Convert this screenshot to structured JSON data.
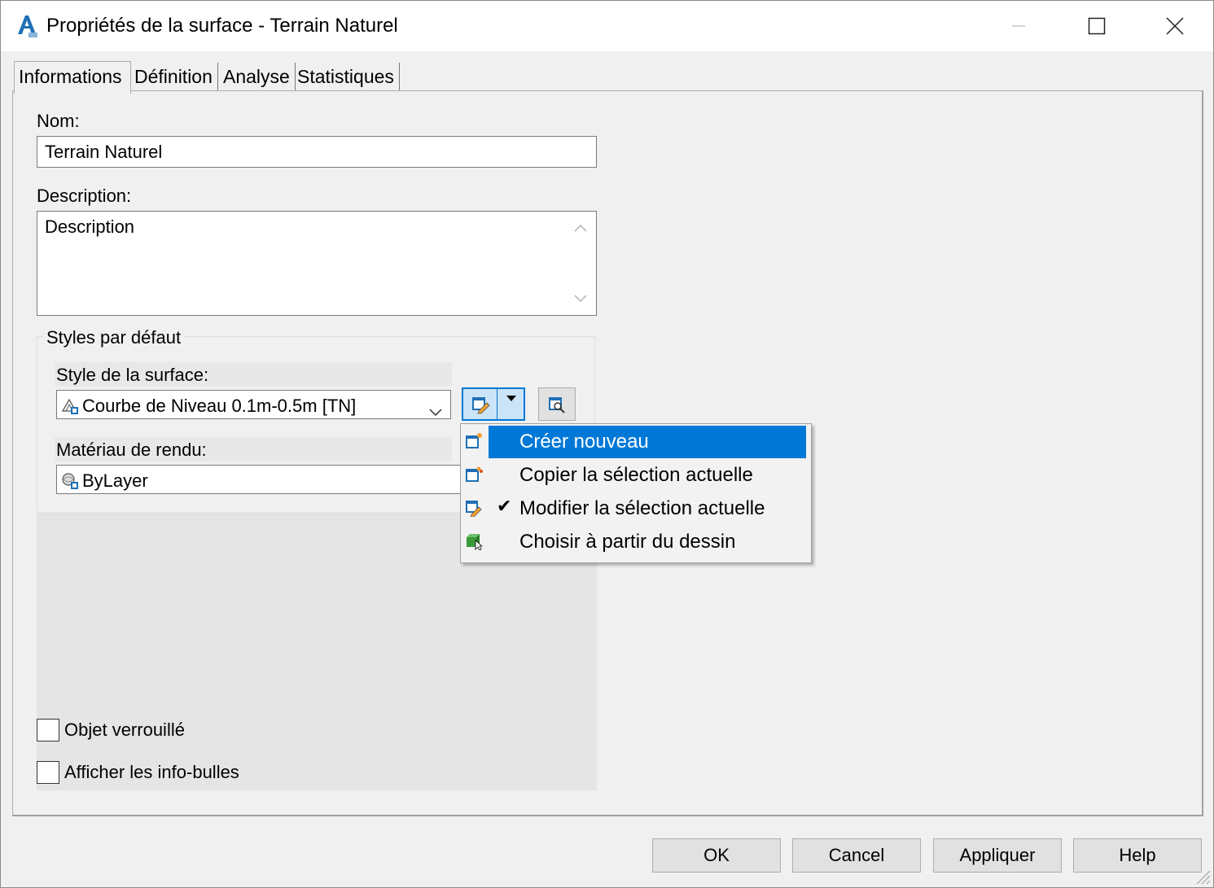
{
  "window": {
    "title": "Propriétés de la surface - Terrain Naturel"
  },
  "tabs": [
    {
      "label": "Informations"
    },
    {
      "label": "Définition"
    },
    {
      "label": "Analyse"
    },
    {
      "label": "Statistiques"
    }
  ],
  "form": {
    "name_label": "Nom:",
    "name_value": "Terrain Naturel",
    "description_label": "Description:",
    "description_value": "Description",
    "styles_group_title": "Styles par défaut",
    "surface_style_label": "Style de la surface:",
    "surface_style_value": "Courbe de Niveau 0.1m-0.5m [TN]",
    "render_material_label": "Matériau de rendu:",
    "render_material_value": "ByLayer",
    "locked_label": "Objet verrouillé",
    "locked_checked": false,
    "tooltips_label": "Afficher les info-bulles",
    "tooltips_checked": false
  },
  "menu": {
    "items": [
      {
        "label": "Créer nouveau",
        "icon": "create-style-icon",
        "checked": false,
        "highlighted": true
      },
      {
        "label": "Copier la sélection actuelle",
        "icon": "copy-style-icon",
        "checked": false,
        "highlighted": false
      },
      {
        "label": "Modifier la sélection actuelle",
        "icon": "edit-style-icon",
        "checked": true,
        "highlighted": false
      },
      {
        "label": "Choisir à partir du dessin",
        "icon": "pick-from-drawing-icon",
        "checked": false,
        "highlighted": false
      }
    ]
  },
  "buttons": {
    "ok": "OK",
    "cancel": "Cancel",
    "apply": "Appliquer",
    "help": "Help"
  },
  "colors": {
    "accent": "#0078d7",
    "highlight_text": "#ffffff"
  }
}
